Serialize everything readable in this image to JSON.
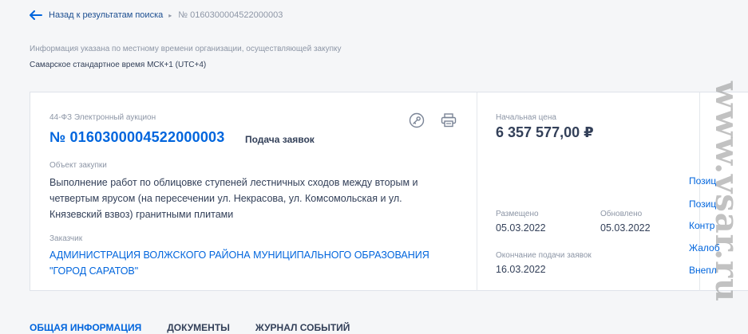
{
  "breadcrumb": {
    "back_label": "Назад к результатам поиска",
    "separator": "▸",
    "current": "№ 0160300004522000003"
  },
  "timezone": {
    "note": "Информация указана по местному времени организации, осуществляющей закупку",
    "value": "Самарское стандартное время МСК+1 (UTC+4)"
  },
  "procurement": {
    "law_type": "44-ФЗ Электронный аукцион",
    "number": "№ 0160300004522000003",
    "stage": "Подача заявок",
    "object_label": "Объект закупки",
    "object_text": "Выполнение работ по облицовке ступеней лестничных сходов между вторым и четвертым ярусом (на пересечении ул. Некрасова, ул. Комсомольская и ул. Князевский взвоз) гранитными плитами",
    "customer_label": "Заказчик",
    "customer_name": "АДМИНИСТРАЦИЯ ВОЛЖСКОГО РАЙОНА МУНИЦИПАЛЬНОГО ОБРАЗОВАНИЯ \"ГОРОД САРАТОВ\""
  },
  "price": {
    "label": "Начальная цена",
    "value": "6 357 577,00 ₽"
  },
  "dates": {
    "placed_label": "Размещено",
    "placed_value": "05.03.2022",
    "updated_label": "Обновлено",
    "updated_value": "05.03.2022",
    "end_label": "Окончание подачи заявок",
    "end_value": "16.03.2022"
  },
  "side_links": [
    "Позиц",
    "Позиц",
    "Контр",
    "Жалоб",
    "Внепл"
  ],
  "tabs": [
    "ОБЩАЯ ИНФОРМАЦИЯ",
    "ДОКУМЕНТЫ",
    "ЖУРНАЛ СОБЫТИЙ"
  ],
  "watermark": "www.vsar.ru",
  "colors": {
    "accent": "#0065dd",
    "text": "#334059",
    "muted": "#8d96a6",
    "background": "#f5f6f8"
  },
  "icons": {
    "back": "arrow-left-icon",
    "key": "key-icon",
    "print": "printer-icon"
  }
}
